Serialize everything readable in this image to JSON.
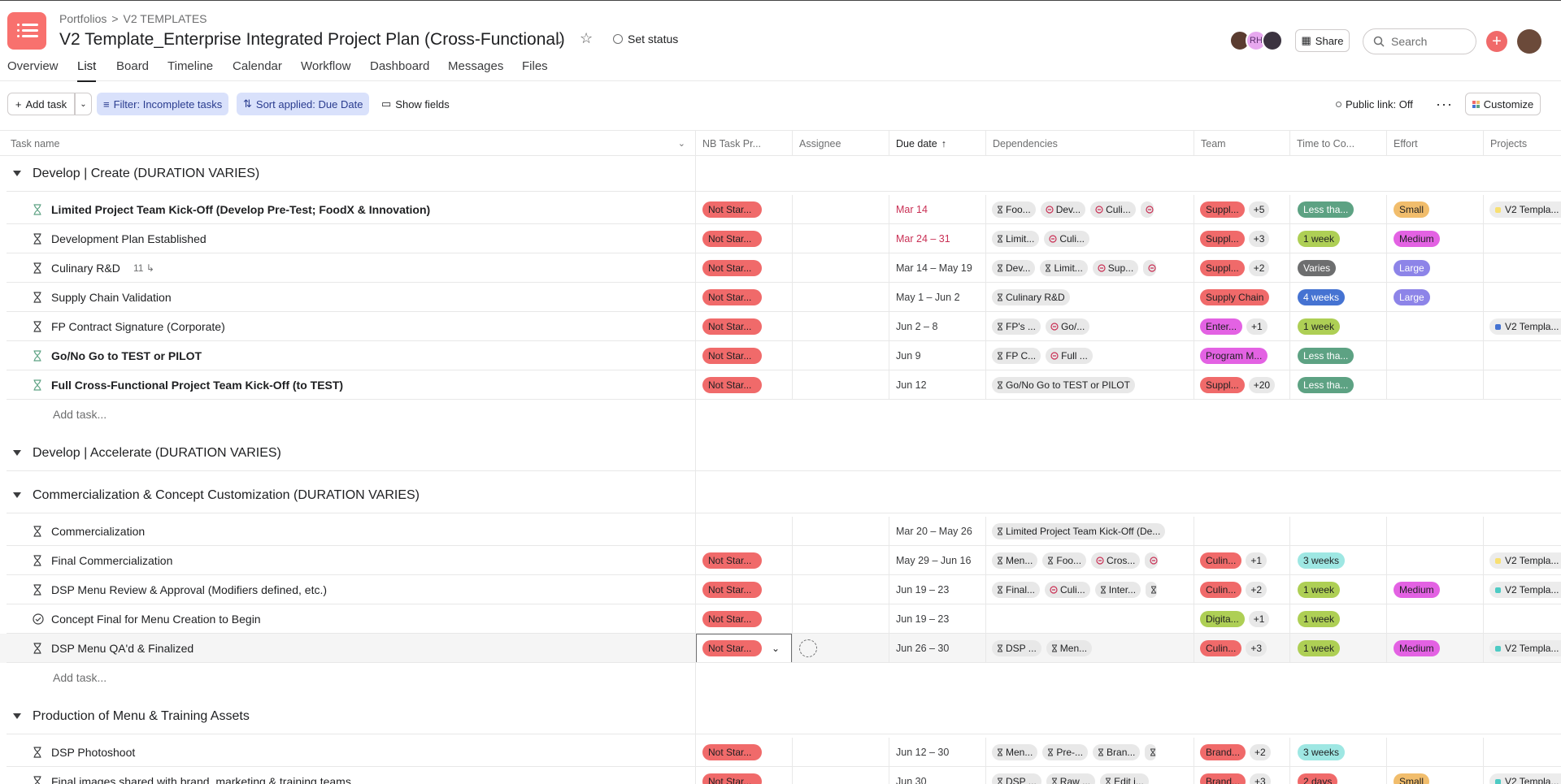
{
  "breadcrumb": {
    "portfolios": "Portfolios",
    "sep": ">",
    "templates": "V2 TEMPLATES"
  },
  "project": {
    "title": "V2 Template_Enterprise Integrated Project Plan (Cross-Functional)",
    "set_status": "Set status"
  },
  "tabs": [
    "Overview",
    "List",
    "Board",
    "Timeline",
    "Calendar",
    "Workflow",
    "Dashboard",
    "Messages",
    "Files"
  ],
  "active_tab": "List",
  "header_right": {
    "avatar_initials": "RH",
    "share": "Share",
    "search_placeholder": "Search"
  },
  "toolbar": {
    "add_task": "Add task",
    "filter": "Filter: Incomplete tasks",
    "sort": "Sort applied: Due Date",
    "show_fields": "Show fields",
    "public_link": "Public link: Off",
    "customize": "Customize"
  },
  "columns": {
    "task_name": "Task name",
    "nb_task": "NB Task Pr...",
    "assignee": "Assignee",
    "due_date": "Due date",
    "dependencies": "Dependencies",
    "team": "Team",
    "time": "Time to Co...",
    "effort": "Effort",
    "projects": "Projects"
  },
  "sections": [
    "Develop | Create (DURATION VARIES)",
    "Develop | Accelerate (DURATION VARIES)",
    "Commercialization & Concept Customization (DURATION VARIES)",
    "Production of Menu & Training Assets"
  ],
  "add_task_label": "Add task...",
  "status_label": "Not Star...",
  "tasks": [
    {
      "name": "Limited Project Team Kick-Off (Develop Pre-Test; FoodX & Innovation)",
      "date": "Mar 14",
      "deps": [
        "Foo...",
        "Dev...",
        "Culi..."
      ],
      "team": "Suppl...",
      "team_more": "+5",
      "time": "Less tha...",
      "effort": "Small",
      "project": "V2 Templa..."
    },
    {
      "name": "Development Plan Established",
      "date": "Mar 24 – 31",
      "deps": [
        "Limit...",
        "Culi..."
      ],
      "team": "Suppl...",
      "team_more": "+3",
      "time": "1 week",
      "effort": "Medium"
    },
    {
      "name": "Culinary R&D",
      "subtasks": "11",
      "date": "Mar 14 – May 19",
      "deps": [
        "Dev...",
        "Limit...",
        "Sup..."
      ],
      "team": "Suppl...",
      "team_more": "+2",
      "time": "Varies",
      "effort": "Large"
    },
    {
      "name": "Supply Chain Validation",
      "date": "May 1 – Jun 2",
      "deps": [
        "Culinary R&D"
      ],
      "team": "Supply Chain",
      "time": "4 weeks",
      "effort": "Large"
    },
    {
      "name": "FP Contract Signature (Corporate)",
      "date": "Jun 2 – 8",
      "deps": [
        "FP's ...",
        "Go/..."
      ],
      "team": "Enter...",
      "team_more": "+1",
      "time": "1 week",
      "project": "V2 Templa..."
    },
    {
      "name": "Go/No Go to TEST or PILOT",
      "date": "Jun 9",
      "deps": [
        "FP C...",
        "Full ..."
      ],
      "team": "Program M...",
      "time": "Less tha..."
    },
    {
      "name": "Full Cross-Functional Project Team Kick-Off (to TEST)",
      "date": "Jun 12",
      "deps": [
        "Go/No Go to TEST or PILOT"
      ],
      "team": "Suppl...",
      "team_more": "+20",
      "time": "Less tha..."
    },
    {
      "name": "Commercialization",
      "date": "Mar 20 – May 26",
      "deps": [
        "Limited Project Team Kick-Off (De..."
      ]
    },
    {
      "name": "Final Commercialization",
      "date": "May 29 – Jun 16",
      "deps": [
        "Men...",
        "Foo...",
        "Cros..."
      ],
      "team": "Culin...",
      "team_more": "+1",
      "time": "3 weeks",
      "project": "V2 Templa..."
    },
    {
      "name": "DSP Menu Review & Approval (Modifiers defined, etc.)",
      "date": "Jun 19 – 23",
      "deps": [
        "Final...",
        "Culi...",
        "Inter..."
      ],
      "team": "Culin...",
      "team_more": "+2",
      "time": "1 week",
      "effort": "Medium",
      "project": "V2 Templa..."
    },
    {
      "name": "Concept Final for Menu Creation to Begin",
      "date": "Jun 19 – 23",
      "team": "Digita...",
      "team_more": "+1",
      "time": "1 week"
    },
    {
      "name": "DSP Menu QA'd & Finalized",
      "date": "Jun 26 – 30",
      "deps": [
        "DSP ...",
        "Men..."
      ],
      "team": "Culin...",
      "team_more": "+3",
      "time": "1 week",
      "effort": "Medium",
      "project": "V2 Templa..."
    },
    {
      "name": "DSP Photoshoot",
      "date": "Jun 12 – 30",
      "deps": [
        "Men...",
        "Pre-...",
        "Bran..."
      ],
      "team": "Brand...",
      "team_more": "+2",
      "time": "3 weeks"
    },
    {
      "name": "Final images shared with brand, marketing & training teams",
      "date": "Jun 30",
      "deps": [
        "DSP ...",
        "Raw ...",
        "Edit i..."
      ],
      "team": "Brand...",
      "team_more": "+3",
      "time": "2 days",
      "effort": "Small",
      "project": "V2 Templa..."
    }
  ]
}
